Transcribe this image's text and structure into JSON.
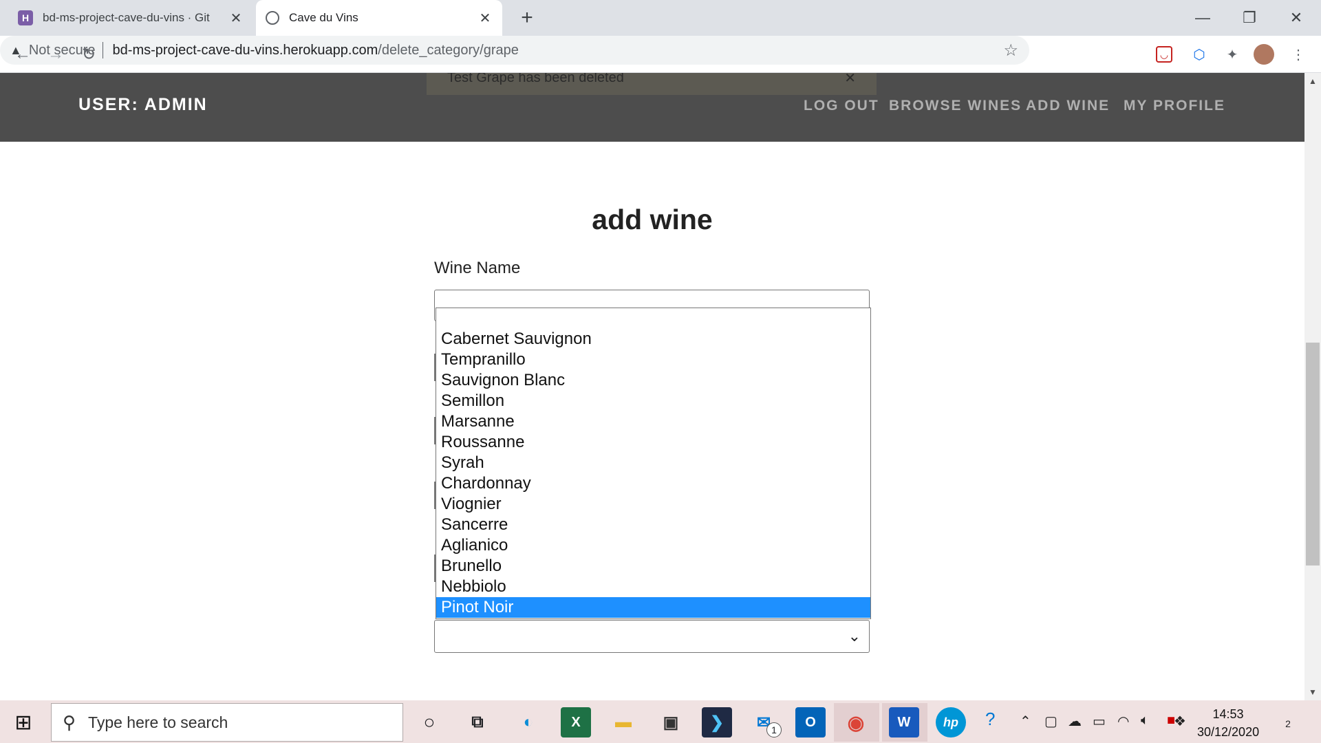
{
  "browser": {
    "tabs": [
      {
        "title": "bd-ms-project-cave-du-vins · Git",
        "favicon": "heroku-icon"
      },
      {
        "title": "Cave du Vins",
        "favicon": "globe-icon"
      }
    ],
    "new_tab": "+",
    "window_controls": {
      "minimize": "—",
      "restore": "❐",
      "close": "✕"
    },
    "security_label": "Not secure",
    "url_host": "bd-ms-project-cave-du-vins.herokuapp.com",
    "url_path": "/delete_category/grape"
  },
  "site": {
    "flash_message": "Test Grape has been deleted",
    "flash_close": "✕",
    "brand": "USER: ADMIN",
    "nav": [
      "LOG OUT",
      "BROWSE WINES",
      "ADD WINE",
      "MY PROFILE"
    ]
  },
  "form": {
    "title": "add wine",
    "wine_name_label": "Wine Name",
    "wine_name_value": "",
    "grape_options": [
      "Cabernet Sauvignon",
      "Tempranillo",
      "Sauvignon Blanc",
      "Semillon",
      "Marsanne",
      "Roussanne",
      "Syrah",
      "Chardonnay",
      "Viognier",
      "Sancerre",
      "Aglianico",
      "Brunello",
      "Nebbiolo",
      "Pinot Noir"
    ],
    "highlighted_option": "Pinot Noir"
  },
  "taskbar": {
    "search_placeholder": "Type here to search",
    "mail_badge": "1",
    "time": "14:53",
    "date": "30/12/2020",
    "notification_count": "2"
  },
  "colors": {
    "nav_bg": "#4d4d4d",
    "highlight": "#1e90ff",
    "taskbar_bg": "#f0e2e2"
  }
}
